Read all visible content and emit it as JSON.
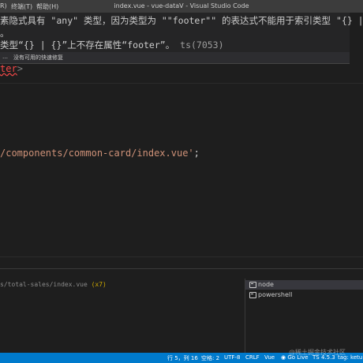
{
  "window": {
    "title": "index.vue - vue-dataV - Visual Studio Code",
    "menu": [
      {
        "label": "R)"
      },
      {
        "label": "终端(T)"
      },
      {
        "label": "帮助(H)"
      }
    ]
  },
  "hover": {
    "line1": "素隐式具有 \"any\" 类型，因为类型为 \"\"footer\"\" 的表达式不能用于索引类型 \"{} |",
    "line2": "。",
    "line3_main": "类型“{} | {}”上不存在属性“footer”。",
    "line3_source": "ts(7053)",
    "quick_fix": "没有可用的快速修复"
  },
  "editor": {
    "tag_text": "ter",
    "tag_close": ">",
    "import_path": "/components/common-card/index.vue'",
    "import_end": ";"
  },
  "terminal": {
    "line_text": "s/total-sales/index.vue",
    "line_count": "(x7)",
    "instances": [
      {
        "label": "node",
        "selected": true
      },
      {
        "label": "powershell",
        "selected": false
      }
    ]
  },
  "statusbar": {
    "position": "行 5，列 16",
    "spaces": "空格: 2",
    "encoding": "UTF-8",
    "eol": "CRLF",
    "language": "Vue",
    "go_live": "Go Live",
    "ts_version": "TS 4.5.3",
    "extra": "tag: ketub",
    "watermark": "@稀土掘金技术社区"
  }
}
